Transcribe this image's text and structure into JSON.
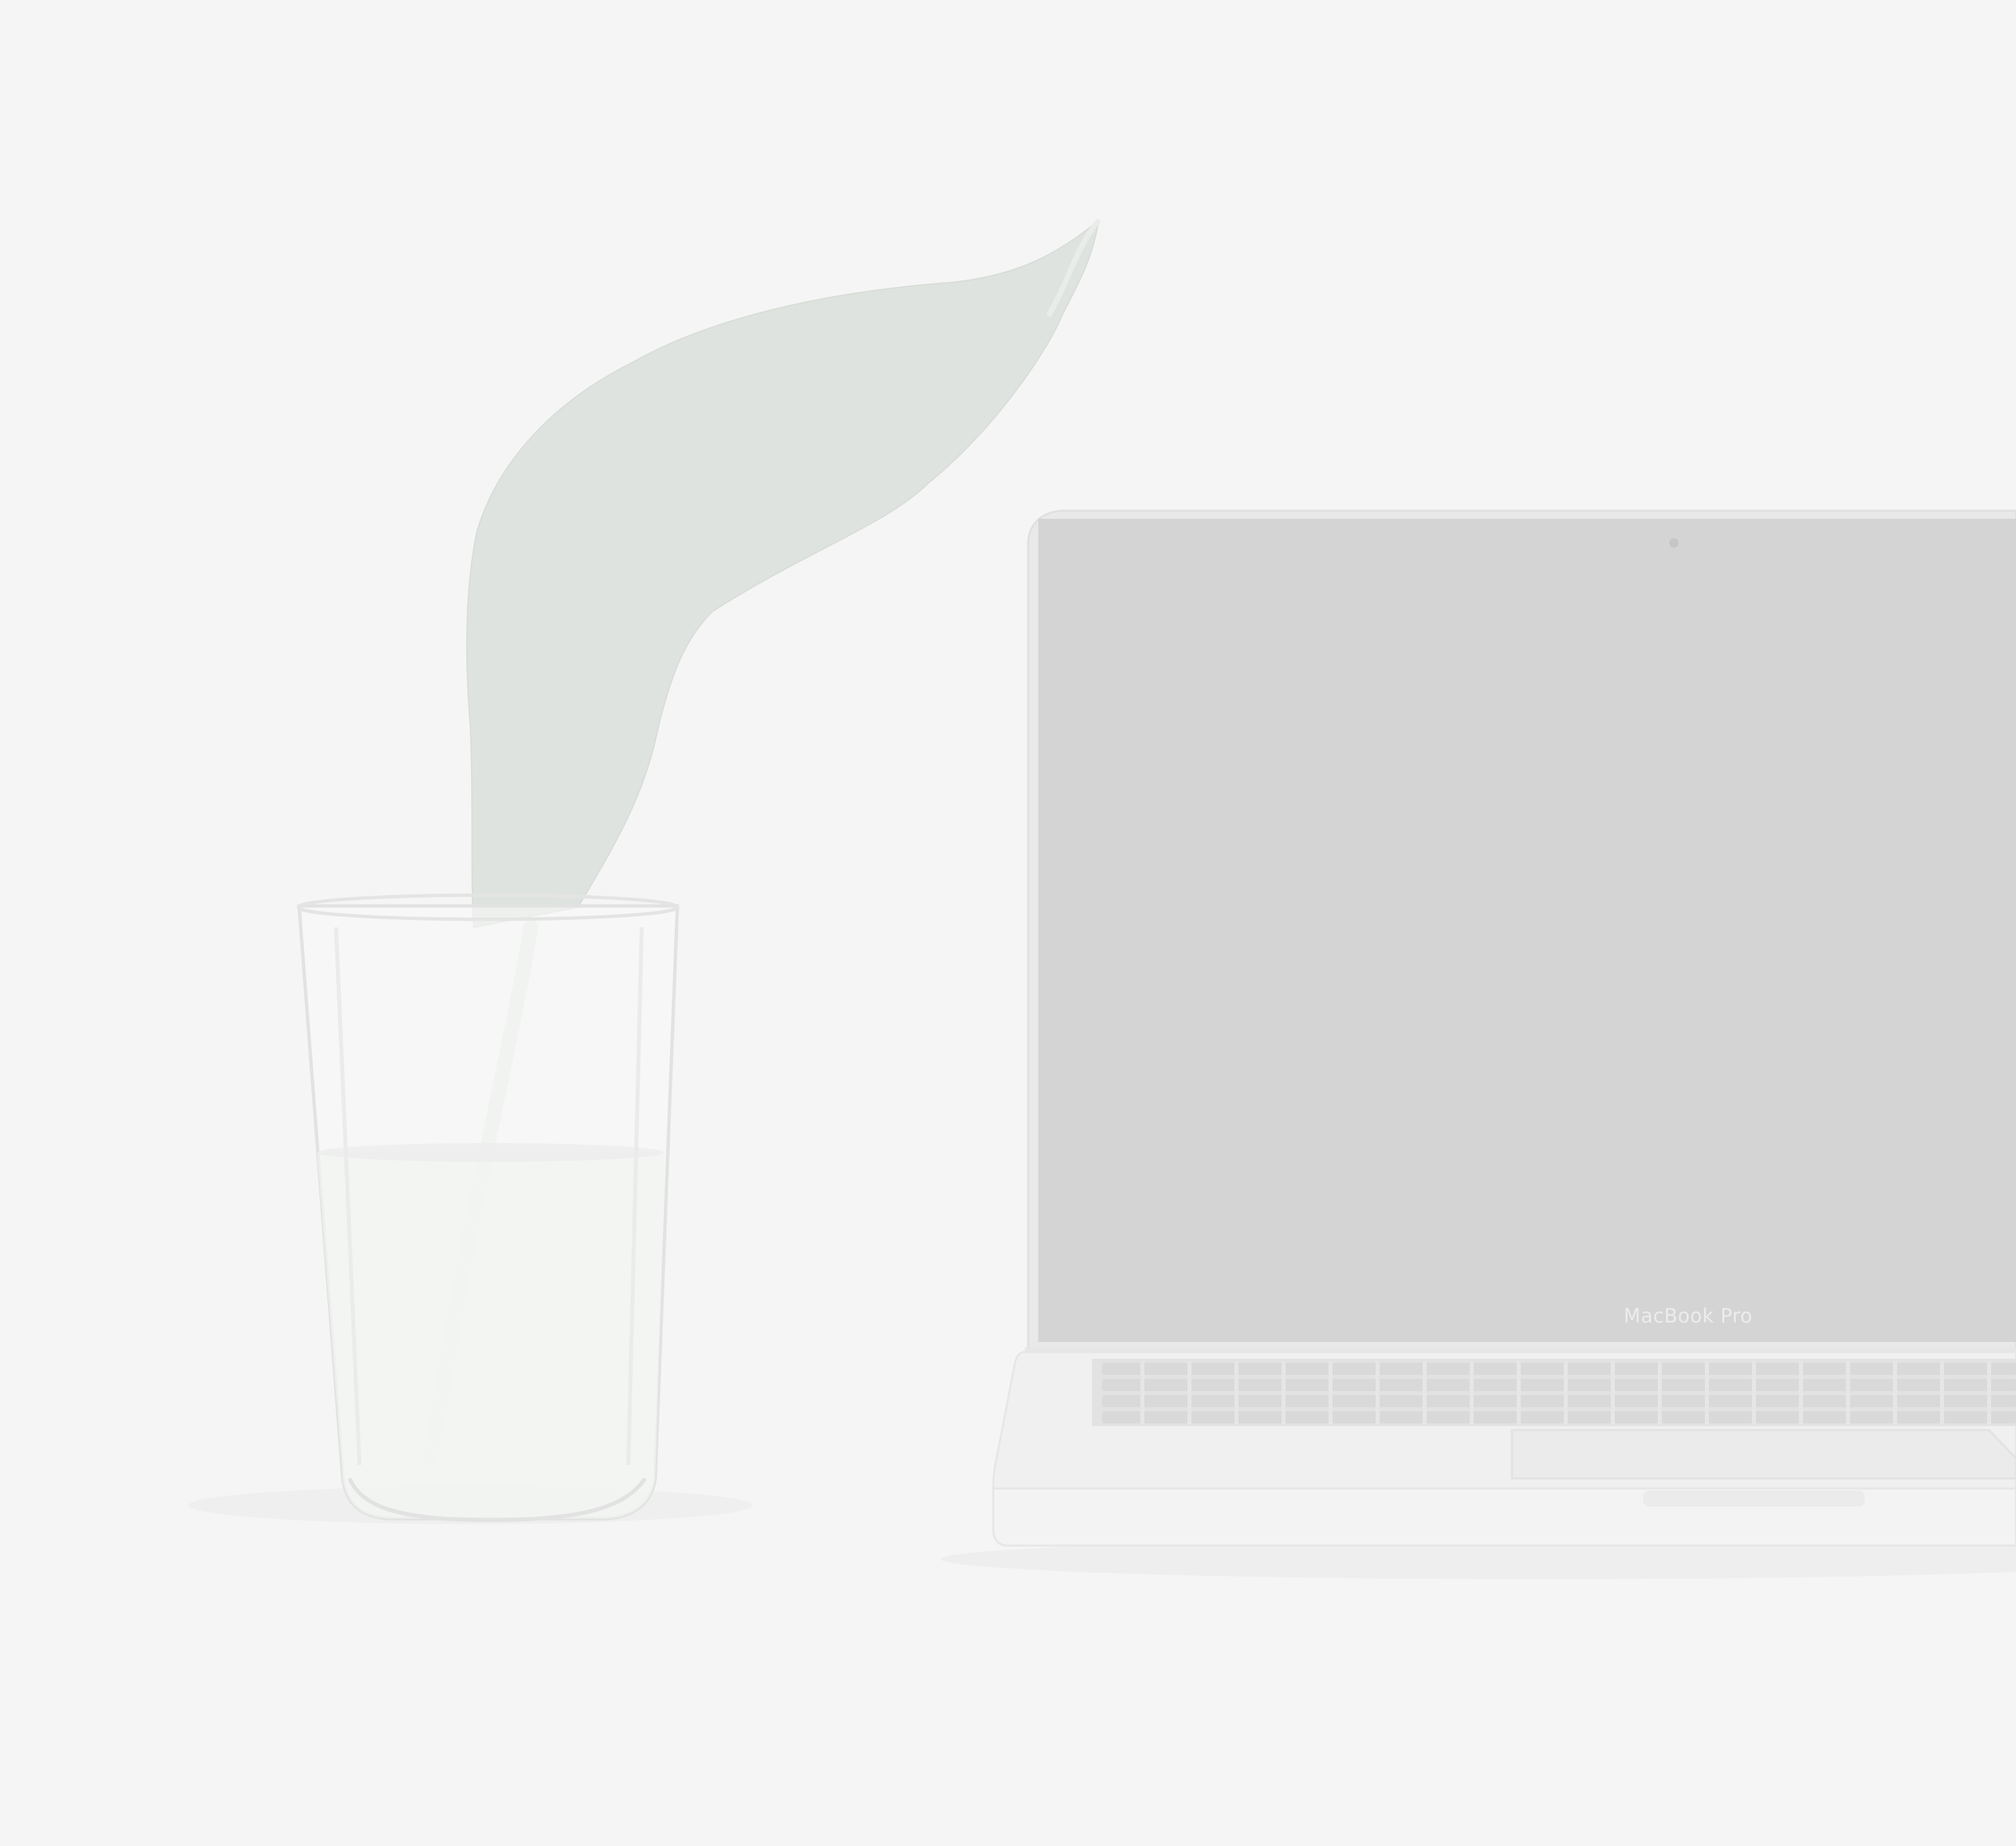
{
  "scene": {
    "description_label": "",
    "laptop": {
      "brand_label": "MacBook Pro",
      "screen_color": "#d4d4d4",
      "body_color": "#f0f0f0",
      "keyboard_color": "#e4e4e4"
    },
    "glass": {
      "water_level": 0.55
    },
    "leaf": {
      "color": "#dfe3df"
    },
    "background_color": "#f5f5f5"
  }
}
